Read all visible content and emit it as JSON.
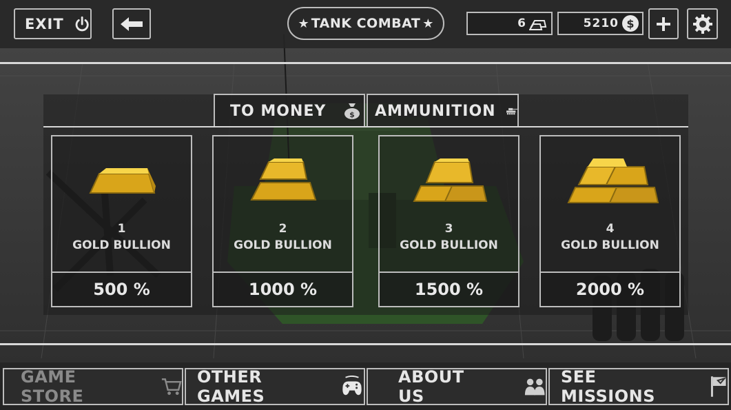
{
  "header": {
    "exit_label": "EXIT",
    "title": "TANK COMBAT",
    "gold_count": "6",
    "money_count": "5210"
  },
  "tabs": [
    {
      "label": "TO MONEY",
      "icon": "money-bag-icon"
    },
    {
      "label": "AMMUNITION",
      "icon": "tank-icon"
    }
  ],
  "cards": [
    {
      "number": "1",
      "name": "GOLD BULLION",
      "percent": "500 %",
      "icon": "gold-bar-icon"
    },
    {
      "number": "2",
      "name": "GOLD BULLION",
      "percent": "1000 %",
      "icon": "gold-bars-icon"
    },
    {
      "number": "3",
      "name": "GOLD BULLION",
      "percent": "1500 %",
      "icon": "gold-bars-icon"
    },
    {
      "number": "4",
      "name": "GOLD BULLION",
      "percent": "2000 %",
      "icon": "gold-bars-icon"
    }
  ],
  "footer": [
    {
      "label": "GAME STORE",
      "icon": "cart-icon",
      "dimmed": true
    },
    {
      "label": "OTHER GAMES",
      "icon": "gamepad-icon"
    },
    {
      "label": "ABOUT US",
      "icon": "people-icon"
    },
    {
      "label": "SEE MISSIONS",
      "icon": "flag-icon"
    }
  ],
  "colors": {
    "gold": "#f1c232",
    "border": "#bdbdbd",
    "tank_green": "#3e6b34"
  }
}
